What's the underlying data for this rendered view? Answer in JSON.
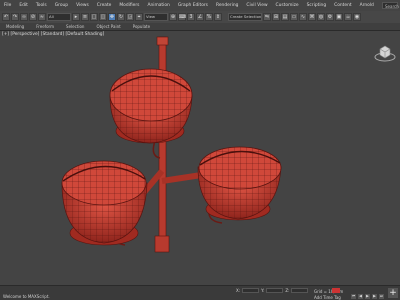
{
  "menubar": {
    "items": [
      "File",
      "Edit",
      "Tools",
      "Group",
      "Views",
      "Create",
      "Modifiers",
      "Animation",
      "Graph Editors",
      "Rendering",
      "Civil View",
      "Customize",
      "Scripting",
      "Content",
      "Arnold",
      "Help"
    ],
    "search_label": "Search"
  },
  "toolbar": {
    "selection_filter": "All",
    "view_dropdown": "View",
    "named_selection": "Create Selection Se"
  },
  "ribbon": {
    "tabs": [
      "Modeling",
      "Freeform",
      "Selection",
      "Object Paint",
      "Populate"
    ]
  },
  "viewport": {
    "label": "[+] [Perspective] [Standard] [Default Shading]",
    "model_color": "#c0392b"
  },
  "statusbar": {
    "left_text": "Welcome to MAXScript.",
    "x_label": "X:",
    "y_label": "Y:",
    "z_label": "Z:",
    "grid_text": "Grid = 10,0cm",
    "add_time_tag": "Add Time Tag"
  }
}
